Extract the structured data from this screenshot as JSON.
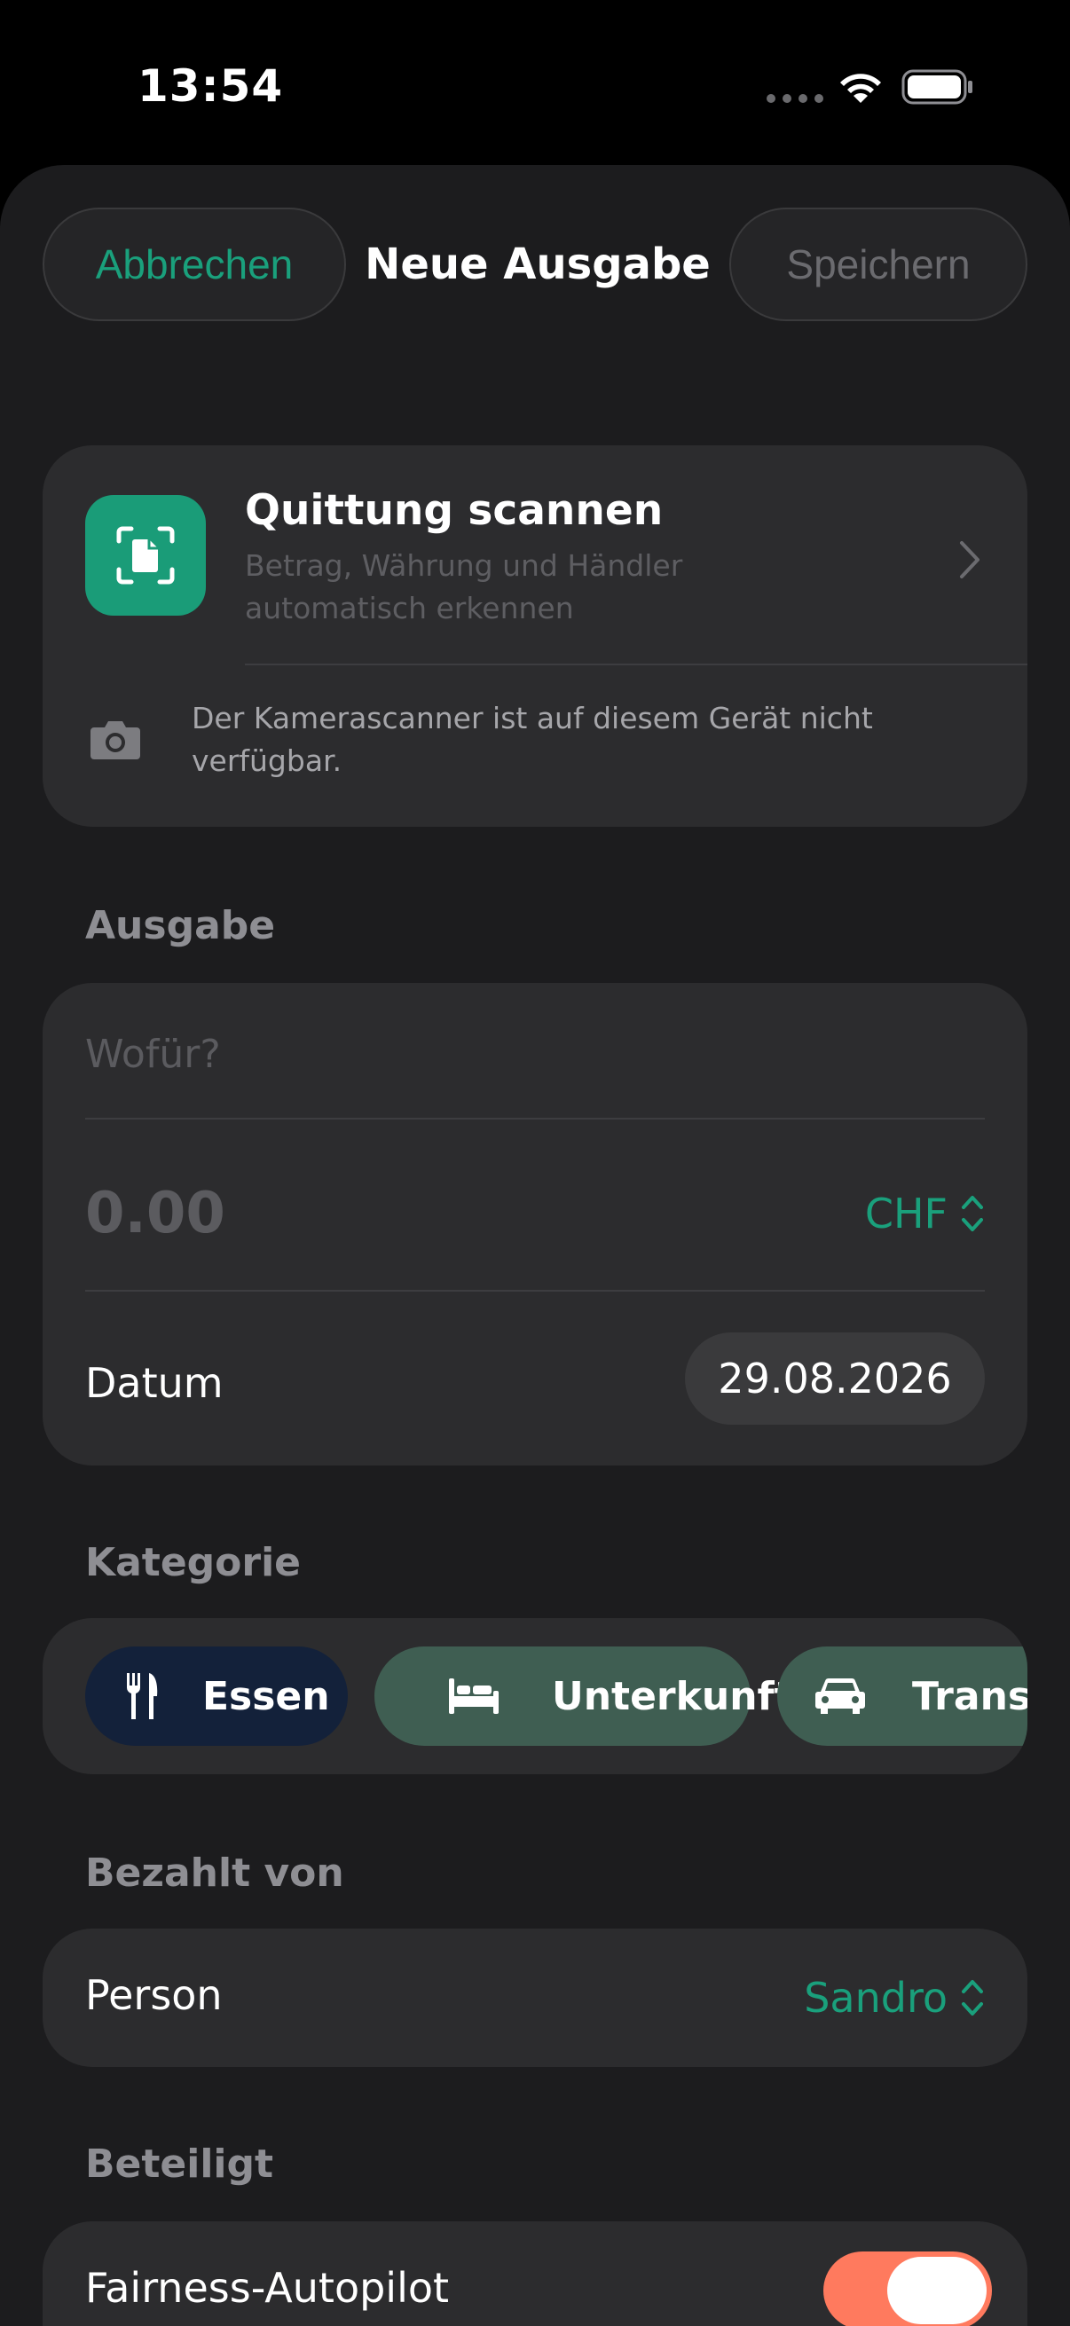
{
  "status_bar": {
    "time": "13:54"
  },
  "nav": {
    "cancel_label": "Abbrechen",
    "title": "Neue Ausgabe",
    "save_label": "Speichern"
  },
  "scan": {
    "title": "Quittung scannen",
    "subtitle": "Betrag, Währung und Händler automatisch erkennen",
    "note": "Der Kamerascanner ist auf diesem Gerät nicht verfügbar."
  },
  "expense": {
    "section_label": "Ausgabe",
    "purpose_placeholder": "Wofür?",
    "amount_placeholder": "0.00",
    "currency": "CHF",
    "date_label": "Datum",
    "date_value": "29.08.2026"
  },
  "category": {
    "section_label": "Kategorie",
    "chips": [
      {
        "label": "Essen",
        "icon": "fork-knife-icon",
        "selected": true
      },
      {
        "label": "Unterkunft",
        "icon": "bed-icon",
        "selected": false
      },
      {
        "label": "Transport",
        "icon": "car-icon",
        "selected": false
      }
    ]
  },
  "payer": {
    "section_label": "Bezahlt von",
    "label": "Person",
    "value": "Sandro"
  },
  "participants": {
    "section_label": "Beteiligt",
    "fairness_label": "Fairness-Autopilot",
    "fairness_on": true
  },
  "colors": {
    "accent": "#1aa07c",
    "toggle_on": "#ff7a5e",
    "sheet_bg": "#1c1c1e",
    "card_bg": "#2c2c2e"
  }
}
